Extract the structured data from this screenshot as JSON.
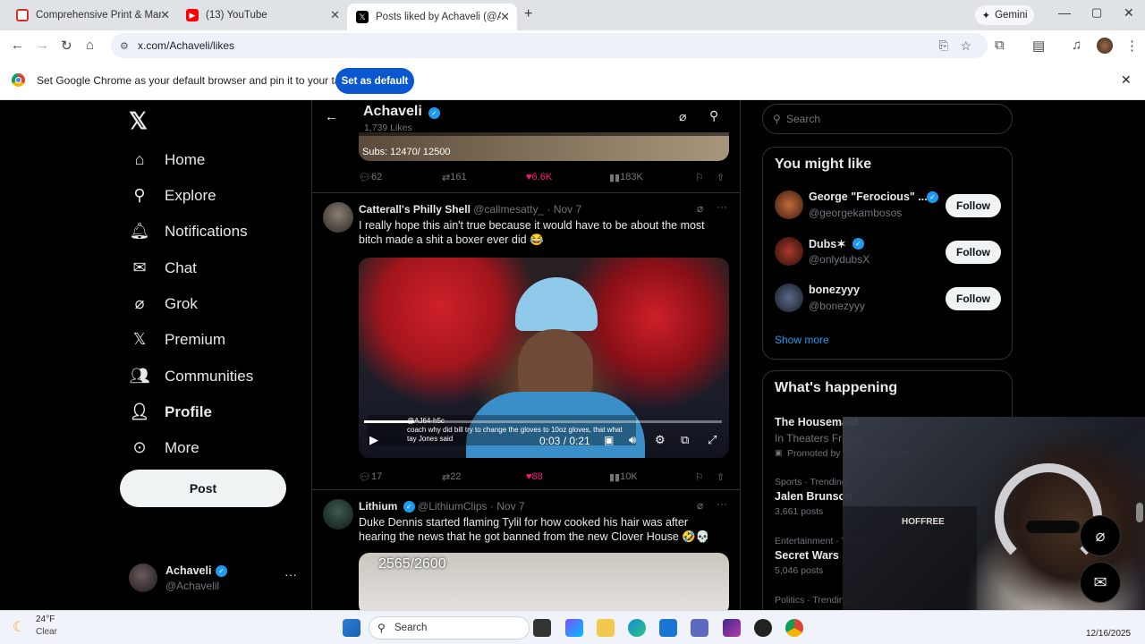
{
  "browser": {
    "tabs": [
      {
        "title": "Comprehensive Print & Marketi",
        "fav_color": "#d93025"
      },
      {
        "title": "(13) YouTube",
        "fav_color": "#ff0000"
      },
      {
        "title": "Posts liked by Achaveli (@Acha",
        "fav_color": "#000000"
      }
    ],
    "gemini_label": "Gemini",
    "url": "x.com/Achaveli/likes",
    "infobar_text": "Set Google Chrome as your default browser and pin it to your taskbar",
    "set_default_label": "Set as default"
  },
  "nav": {
    "items": [
      {
        "label": "Home",
        "icon": "home-icon"
      },
      {
        "label": "Explore",
        "icon": "search-icon"
      },
      {
        "label": "Notifications",
        "icon": "bell-icon"
      },
      {
        "label": "Chat",
        "icon": "mail-icon"
      },
      {
        "label": "Grok",
        "icon": "grok-icon"
      },
      {
        "label": "Premium",
        "icon": "x-icon"
      },
      {
        "label": "Communities",
        "icon": "people-icon"
      },
      {
        "label": "Profile",
        "icon": "person-icon"
      },
      {
        "label": "More",
        "icon": "more-circle-icon"
      }
    ],
    "post_label": "Post",
    "account": {
      "name": "Achaveli",
      "handle": "@Achavelil"
    }
  },
  "header": {
    "name": "Achaveli",
    "likes": "1,739 Likes"
  },
  "top_tweet": {
    "media_caption": "Subs: 12470/ 12500",
    "replies": "62",
    "reposts": "161",
    "likes": "6.6K",
    "views": "183K"
  },
  "tweet1": {
    "name": "Catterall's Philly Shell",
    "handle": "@callmesatty_",
    "date": "· Nov 7",
    "text": "I really hope this ain't true because it would have to be about the most bitch made a shit a boxer ever did 😂",
    "video_time": "0:03 / 0:21",
    "video_caption_user": "@AJ64-h5c",
    "video_caption_text": "coach why did bill try to change the gloves to 10oz gloves, that what",
    "video_caption_sub": "tay Jones said",
    "replies": "17",
    "reposts": "22",
    "likes": "88",
    "views": "10K"
  },
  "tweet2": {
    "name": "Lithium",
    "handle": "@LithiumClips",
    "date": "· Nov 7",
    "text": "Duke Dennis started flaming Tylil for how cooked his hair was after hearing the news that he got banned from the new Clover House 🤣💀",
    "media_caption": "2565/2600"
  },
  "right": {
    "search_placeholder": "Search",
    "might_like_title": "You might like",
    "suggestions": [
      {
        "name": "George \"Ferocious\" ...",
        "handle": "@georgekambosos",
        "verified": true
      },
      {
        "name": "Dubs✶",
        "handle": "@onlydubsX",
        "verified": true
      },
      {
        "name": "bonezyyy",
        "handle": "@bonezyyy",
        "verified": false
      }
    ],
    "follow_label": "Follow",
    "show_more": "Show more",
    "happening_title": "What's happening",
    "trends": [
      {
        "meta": "",
        "title": "The Housemaid",
        "sub": "In Theaters Friday",
        "extra": "Promoted by The Housemaid"
      },
      {
        "meta": "Sports · Trending",
        "title": "Jalen Brunson",
        "sub": "3,661 posts",
        "extra": ""
      },
      {
        "meta": "Entertainment · Trending",
        "title": "Secret Wars",
        "sub": "5,046 posts",
        "extra": ""
      },
      {
        "meta": "Politics · Trending",
        "title": "",
        "sub": "",
        "extra": ""
      }
    ]
  },
  "overlay": {
    "banner": "HOFFREE"
  },
  "taskbar": {
    "temp": "24°F",
    "weather": "Clear",
    "search_label": "Search",
    "date": "12/16/2025"
  }
}
